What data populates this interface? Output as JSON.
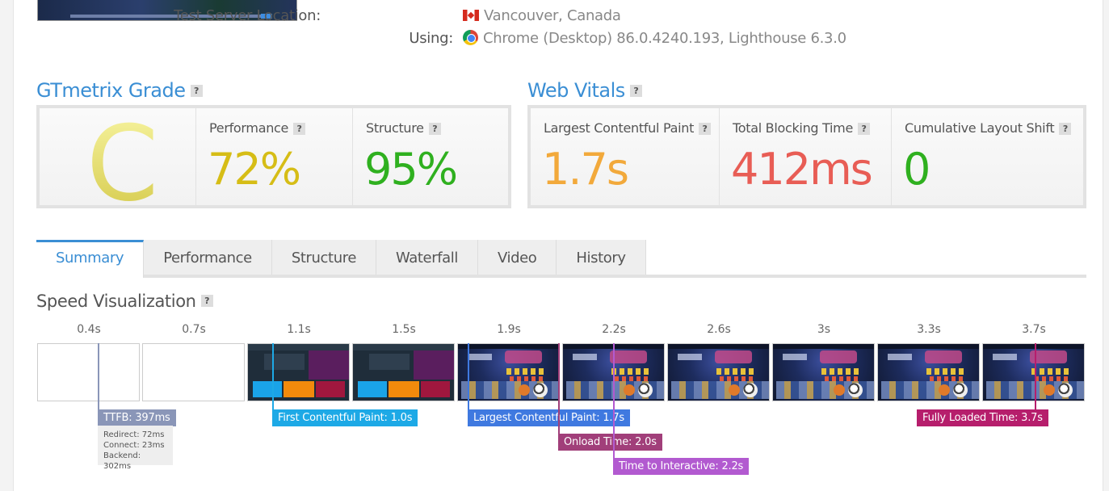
{
  "test_info": {
    "server_location_label": "Test Server Location:",
    "server_location_value": "Vancouver, Canada",
    "using_label": "Using:",
    "using_value": "Chrome (Desktop) 86.0.4240.193, Lighthouse 6.3.0"
  },
  "gtmetrix_grade": {
    "title": "GTmetrix Grade",
    "help": "?",
    "grade": "C",
    "performance_label": "Performance",
    "performance_value": "72%",
    "structure_label": "Structure",
    "structure_value": "95%"
  },
  "web_vitals": {
    "title": "Web Vitals",
    "help": "?",
    "lcp_label": "Largest Contentful Paint",
    "lcp_value": "1.7s",
    "tbt_label": "Total Blocking Time",
    "tbt_value": "412ms",
    "cls_label": "Cumulative Layout Shift",
    "cls_value": "0"
  },
  "colors": {
    "accent": "#3a8ed4",
    "grade_c": "#d8cf45",
    "performance": "#d6bd16",
    "structure": "#2fb01f",
    "lcp": "#f2a93b",
    "tbt": "#e85d55",
    "cls": "#2fb01f",
    "ttfb": "#8a96b8",
    "fcp": "#1da9e6",
    "lcp_marker": "#3f79e0",
    "onload": "#a13f7a",
    "tti": "#b25ad0",
    "fully_loaded": "#b61e6c"
  },
  "tabs": [
    {
      "label": "Summary",
      "active": true
    },
    {
      "label": "Performance",
      "active": false
    },
    {
      "label": "Structure",
      "active": false
    },
    {
      "label": "Waterfall",
      "active": false
    },
    {
      "label": "Video",
      "active": false
    },
    {
      "label": "History",
      "active": false
    }
  ],
  "speed_visualization": {
    "title": "Speed Visualization",
    "help": "?",
    "ticks": [
      "0.4s",
      "0.7s",
      "1.1s",
      "1.5s",
      "1.9s",
      "2.2s",
      "2.6s",
      "3s",
      "3.3s",
      "3.7s"
    ],
    "ttfb_label": "TTFB: 397ms",
    "ttfb_redirect": "Redirect: 72ms",
    "ttfb_connect": "Connect: 23ms",
    "ttfb_backend": "Backend: 302ms",
    "fcp_label": "First Contentful Paint: 1.0s",
    "lcp_label": "Largest Contentful Paint: 1.7s",
    "onload_label": "Onload Time: 2.0s",
    "tti_label": "Time to Interactive: 2.2s",
    "fully_loaded_label": "Fully Loaded Time: 3.7s"
  }
}
